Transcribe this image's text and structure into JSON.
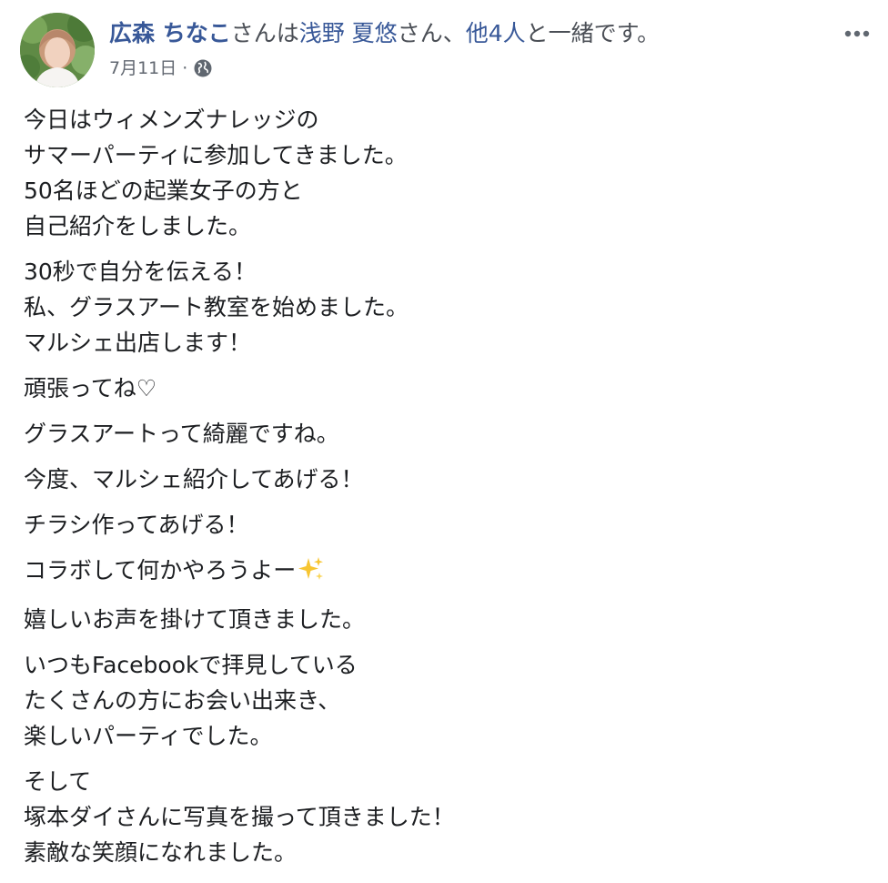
{
  "post": {
    "author_name": "広森 ちなこ",
    "with_prefix": "さんは",
    "tagged_person": "浅野 夏悠",
    "with_mid": "さん、",
    "others_link": "他4人",
    "with_suffix": "と一緒です。",
    "date": "7月11日",
    "separator": "·",
    "privacy_icon": "globe-icon",
    "more_icon": "ellipsis-icon"
  },
  "body": {
    "paragraphs": [
      [
        "今日はウィメンズナレッジの",
        "サマーパーティに参加してきました。",
        "50名ほどの起業女子の方と",
        "自己紹介をしました。"
      ],
      [
        "30秒で自分を伝える！",
        "私、グラスアート教室を始めました。",
        "マルシェ出店します！"
      ],
      [
        "頑張ってね♡"
      ],
      [
        "グラスアートって綺麗ですね。"
      ],
      [
        "今度、マルシェ紹介してあげる！"
      ],
      [
        "チラシ作ってあげる！"
      ],
      [
        "コラボして何かやろうよー"
      ],
      [
        "嬉しいお声を掛けて頂きました。"
      ],
      [
        "いつもFacebookで拝見している",
        "たくさんの方にお会い出来き、",
        "楽しいパーティでした。"
      ],
      [
        "そして",
        "塚本ダイさんに写真を撮って頂きました！",
        "素敵な笑顔になれました。"
      ]
    ],
    "sparkle_icon": "sparkles-icon"
  },
  "colors": {
    "link": "#385898",
    "text": "#1c1e21",
    "meta": "#616770",
    "background": "#ffffff"
  }
}
